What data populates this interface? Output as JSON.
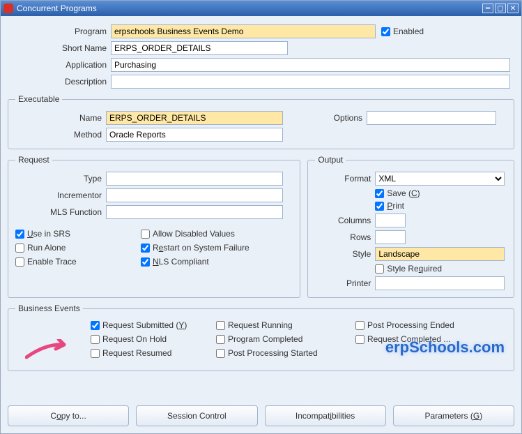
{
  "window": {
    "title": "Concurrent Programs"
  },
  "program": {
    "program_lbl": "Program",
    "program_val": "erpschools Business Events Demo",
    "enabled_lbl": "Enabled",
    "shortname_lbl": "Short Name",
    "shortname_val": "ERPS_ORDER_DETAILS",
    "application_lbl": "Application",
    "application_val": "Purchasing",
    "description_lbl": "Description",
    "description_val": ""
  },
  "executable": {
    "legend": "Executable",
    "name_lbl": "Name",
    "name_val": "ERPS_ORDER_DETAILS",
    "method_lbl": "Method",
    "method_val": "Oracle Reports",
    "options_lbl": "Options",
    "options_val": ""
  },
  "request": {
    "legend": "Request",
    "type_lbl": "Type",
    "type_val": "",
    "incrementor_lbl": "Incrementor",
    "incrementor_val": "",
    "mls_lbl": "MLS Function",
    "mls_val": "",
    "use_srs": "Use in SRS",
    "allow_disabled": "Allow Disabled Values",
    "run_alone": "Run Alone",
    "restart": "Restart on System Failure",
    "enable_trace": "Enable Trace",
    "nls": "NLS Compliant"
  },
  "output": {
    "legend": "Output",
    "format_lbl": "Format",
    "format_val": "XML",
    "save_lbl": "Save (C)",
    "print_lbl": "Print",
    "columns_lbl": "Columns",
    "columns_val": "",
    "rows_lbl": "Rows",
    "rows_val": "",
    "style_lbl": "Style",
    "style_val": "Landscape",
    "style_req_lbl": "Style Required",
    "printer_lbl": "Printer",
    "printer_val": ""
  },
  "events": {
    "legend": "Business Events",
    "req_submitted": "Request Submitted (Y)",
    "req_running": "Request Running",
    "post_ended": "Post Processing Ended",
    "req_hold": "Request On Hold",
    "prog_completed": "Program Completed",
    "req_completed": "Request Completed ...",
    "req_resumed": "Request Resumed",
    "post_started": "Post Processing Started"
  },
  "buttons": {
    "copy": "Copy to...",
    "session": "Session Control",
    "incompat": "Incompatibilities",
    "params": "Parameters (G)"
  },
  "watermark": "erpSchools.com"
}
